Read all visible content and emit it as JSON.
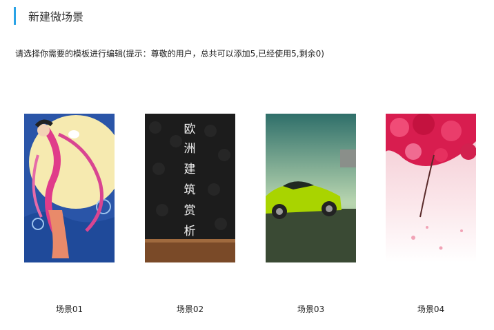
{
  "header": {
    "title": "新建微场景",
    "accent_color": "#2aa3e6"
  },
  "hint": "请选择你需要的模板进行编辑(提示：尊敬的用户，总共可以添加5,已经使用5,剩余0)",
  "templates": [
    {
      "label": "场景01"
    },
    {
      "label": "场景02",
      "thumb_text": [
        "欧",
        "洲",
        "建",
        "筑",
        "赏",
        "析"
      ]
    },
    {
      "label": "场景03"
    },
    {
      "label": "场景04"
    }
  ]
}
